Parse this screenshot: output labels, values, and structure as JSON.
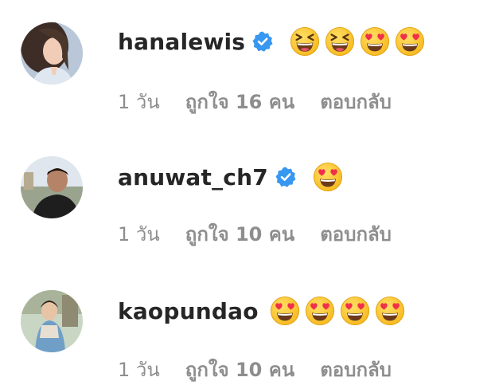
{
  "comments": [
    {
      "username": "hanalewis",
      "verified": true,
      "emojis": [
        "laughing-squint-emoji",
        "laughing-squint-emoji",
        "heart-eyes-emoji",
        "heart-eyes-emoji"
      ],
      "time": "1 วัน",
      "likes": "ถูกใจ 16 คน",
      "reply": "ตอบกลับ"
    },
    {
      "username": "anuwat_ch7",
      "verified": true,
      "emojis": [
        "heart-eyes-emoji"
      ],
      "time": "1 วัน",
      "likes": "ถูกใจ 10 คน",
      "reply": "ตอบกลับ"
    },
    {
      "username": "kaopundao",
      "verified": false,
      "emojis": [
        "heart-eyes-emoji",
        "heart-eyes-emoji",
        "heart-eyes-emoji",
        "heart-eyes-emoji"
      ],
      "time": "1 วัน",
      "likes": "ถูกใจ 10 คน",
      "reply": "ตอบกลับ"
    }
  ],
  "colors": {
    "username": "#262626",
    "meta": "#8e8e8e",
    "verified_badge": "#3897f0",
    "emoji_face": "#ffcc33",
    "heart": "#f0304a"
  }
}
